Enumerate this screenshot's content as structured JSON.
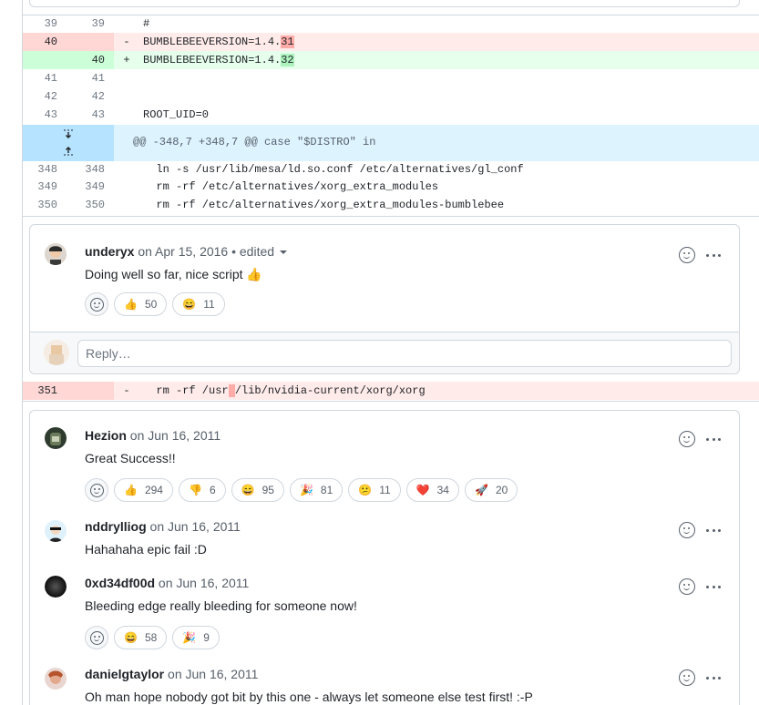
{
  "colors": {
    "deletion_bg": "#ffebe9",
    "addition_bg": "#e6ffec",
    "hunk_bg": "#ddf4ff",
    "border": "#d0d7de",
    "muted_text": "#57606a"
  },
  "diff_top": {
    "lines": [
      {
        "old": "39",
        "new": "39",
        "sign": "",
        "code": "#"
      },
      {
        "old": "40",
        "new": "",
        "sign": "-",
        "code_before": "BUMBLEBEEVERSION=1.4.",
        "code_highlight": "31"
      },
      {
        "old": "",
        "new": "40",
        "sign": "+",
        "code_before": "BUMBLEBEEVERSION=1.4.",
        "code_highlight": "32"
      },
      {
        "old": "41",
        "new": "41",
        "sign": "",
        "code": ""
      },
      {
        "old": "42",
        "new": "42",
        "sign": "",
        "code": ""
      },
      {
        "old": "43",
        "new": "43",
        "sign": "",
        "code": "ROOT_UID=0"
      }
    ],
    "hunk_header": "@@ -348,7 +348,7 @@ case \"$DISTRO\" in",
    "context_lines": [
      {
        "old": "348",
        "new": "348",
        "code": "  ln -s /usr/lib/mesa/ld.so.conf /etc/alternatives/gl_conf"
      },
      {
        "old": "349",
        "new": "349",
        "code": "  rm -rf /etc/alternatives/xorg_extra_modules"
      },
      {
        "old": "350",
        "new": "350",
        "code": "  rm -rf /etc/alternatives/xorg_extra_modules-bumblebee"
      }
    ]
  },
  "thread1": {
    "comment": {
      "author": "underyx",
      "meta": " on Apr 15, 2016 • edited",
      "body": "Doing well so far, nice script 👍",
      "reactions": [
        {
          "emoji": "👍",
          "count": "50"
        },
        {
          "emoji": "😄",
          "count": "11"
        }
      ]
    },
    "reply_placeholder": "Reply…"
  },
  "diff_line_351": {
    "old": "351",
    "sign": "-",
    "code_before": "  rm -rf /usr",
    "code_highlight": " ",
    "code_after": "/lib/nvidia-current/xorg/xorg"
  },
  "thread2": {
    "comments": [
      {
        "author": "Hezion",
        "meta": " on Jun 16, 2011",
        "body": "Great Success!!",
        "reactions": [
          {
            "emoji": "👍",
            "count": "294"
          },
          {
            "emoji": "👎",
            "count": "6"
          },
          {
            "emoji": "😄",
            "count": "95"
          },
          {
            "emoji": "🎉",
            "count": "81"
          },
          {
            "emoji": "😕",
            "count": "11"
          },
          {
            "emoji": "❤️",
            "count": "34"
          },
          {
            "emoji": "🚀",
            "count": "20"
          }
        ]
      },
      {
        "author": "nddrylliog",
        "meta": " on Jun 16, 2011",
        "body": "Hahahaha epic fail :D",
        "reactions": []
      },
      {
        "author": "0xd34df00d",
        "meta": " on Jun 16, 2011",
        "body": "Bleeding edge really bleeding for someone now!",
        "reactions": [
          {
            "emoji": "😄",
            "count": "58"
          },
          {
            "emoji": "🎉",
            "count": "9"
          }
        ]
      },
      {
        "author": "danielgtaylor",
        "meta": " on Jun 16, 2011",
        "body": "Oh man hope nobody got bit by this one - always let someone else test first! :-P",
        "reactions": []
      }
    ]
  }
}
